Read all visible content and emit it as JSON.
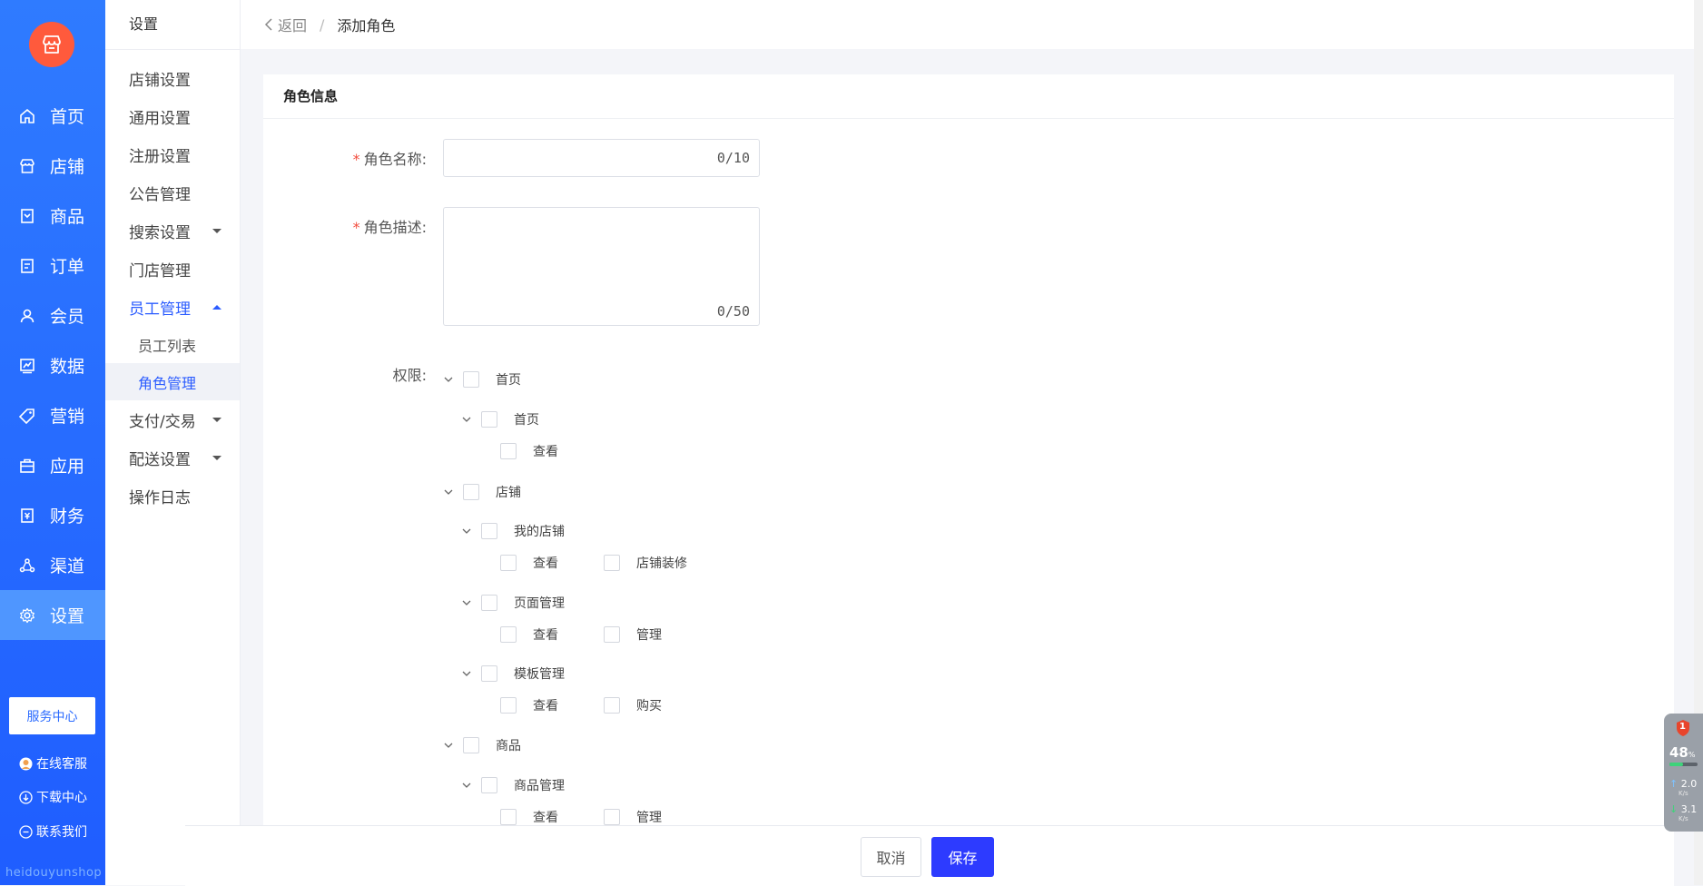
{
  "sidebar": {
    "logo_icon": "store-icon",
    "accent": "#1f5dff",
    "items": [
      {
        "label": "首页",
        "icon": "home-icon"
      },
      {
        "label": "店铺",
        "icon": "shop-icon"
      },
      {
        "label": "商品",
        "icon": "goods-icon"
      },
      {
        "label": "订单",
        "icon": "order-icon"
      },
      {
        "label": "会员",
        "icon": "member-icon"
      },
      {
        "label": "数据",
        "icon": "chart-icon"
      },
      {
        "label": "营销",
        "icon": "tag-icon"
      },
      {
        "label": "应用",
        "icon": "app-icon"
      },
      {
        "label": "财务",
        "icon": "finance-icon"
      },
      {
        "label": "渠道",
        "icon": "channel-icon"
      },
      {
        "label": "设置",
        "icon": "gear-icon"
      }
    ],
    "service_center": "服务中心",
    "links": [
      {
        "label": "在线客服",
        "icon": "avatar-icon"
      },
      {
        "label": "下载中心",
        "icon": "download-icon"
      },
      {
        "label": "联系我们",
        "icon": "chat-icon"
      }
    ],
    "watermark": "heidouyunshop"
  },
  "subnav": {
    "title": "设置",
    "items": [
      {
        "label": "店铺设置"
      },
      {
        "label": "通用设置"
      },
      {
        "label": "注册设置"
      },
      {
        "label": "公告管理"
      },
      {
        "label": "搜索设置"
      },
      {
        "label": "门店管理"
      },
      {
        "label": "员工管理"
      },
      {
        "label": "支付/交易"
      },
      {
        "label": "配送设置"
      },
      {
        "label": "操作日志"
      }
    ],
    "children": [
      {
        "label": "员工列表"
      },
      {
        "label": "角色管理"
      }
    ]
  },
  "topbar": {
    "back_label": "返回",
    "separator": "/",
    "current": "添加角色"
  },
  "card": {
    "title": "角色信息",
    "fields": {
      "name_label": "角色名称:",
      "name_value": "",
      "name_counter": "0/10",
      "desc_label": "角色描述:",
      "desc_value": "",
      "desc_counter": "0/50",
      "perm_label": "权限:"
    },
    "tree": {
      "home": "首页",
      "home_home": "首页",
      "home_home_view": "查看",
      "shop": "店铺",
      "shop_my": "我的店铺",
      "shop_my_view": "查看",
      "shop_my_decor": "店铺装修",
      "shop_page": "页面管理",
      "shop_page_view": "查看",
      "shop_page_manage": "管理",
      "shop_tpl": "模板管理",
      "shop_tpl_view": "查看",
      "shop_tpl_buy": "购买",
      "goods": "商品",
      "goods_mgr": "商品管理",
      "goods_mgr_view": "查看",
      "goods_mgr_manage": "管理"
    }
  },
  "footer": {
    "cancel": "取消",
    "save": "保存",
    "save_color": "#2d3bff"
  },
  "widget": {
    "badge": "1",
    "percent": "48",
    "percent_unit": "%",
    "cpu_fraction": 0.48,
    "up_speed": "2.0",
    "up_unit": "K/s",
    "down_speed": "3.1",
    "down_unit": "K/s"
  }
}
